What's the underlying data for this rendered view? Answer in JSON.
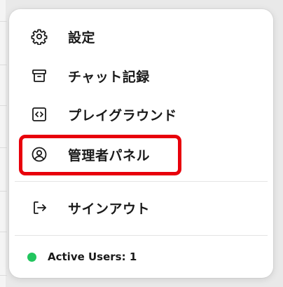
{
  "menu": {
    "items": [
      {
        "label": "設定",
        "icon": "gear-icon"
      },
      {
        "label": "チャット記録",
        "icon": "archive-icon"
      },
      {
        "label": "プレイグラウンド",
        "icon": "code-icon"
      },
      {
        "label": "管理者パネル",
        "icon": "user-circle-icon"
      }
    ],
    "signout": {
      "label": "サインアウト",
      "icon": "sign-out-icon"
    }
  },
  "status": {
    "label": "Active Users:",
    "count": "1",
    "dot_color": "#22c55e"
  },
  "colors": {
    "highlight": "#e8000b",
    "text": "#1a1a1a"
  }
}
